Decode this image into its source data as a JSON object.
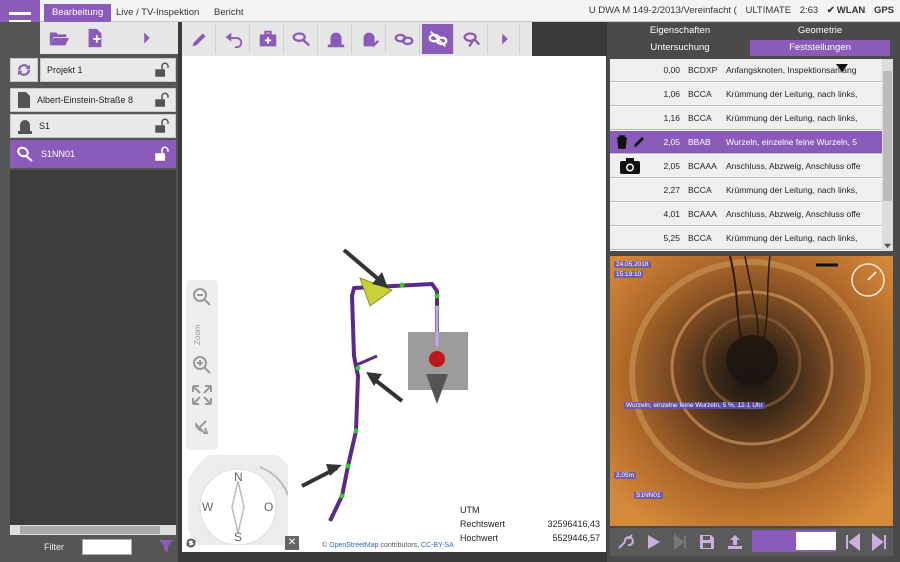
{
  "menu": {
    "tabs": [
      "Bearbeitung",
      "Live / TV-Inspektion",
      "Bericht"
    ],
    "active_tab": 0
  },
  "status": {
    "standard": "U  DWA M 149-2/2013/Vereinfacht (",
    "edition": "ULTIMATE",
    "time": "2:63",
    "wlan": "WLAN",
    "gps": "GPS"
  },
  "project_tree": [
    {
      "label": "Projekt 1",
      "icon": "refresh-icon"
    },
    {
      "label": "Albert-Einstein-Straße 8",
      "icon": "document-icon"
    },
    {
      "label": "S1",
      "icon": "manhole-icon"
    },
    {
      "label": "S1NN01",
      "icon": "pipe-icon",
      "selected": true
    }
  ],
  "filter": {
    "label": "Filter",
    "value": ""
  },
  "map": {
    "zoom_label": "Zoom",
    "compass": {
      "n": "N",
      "w": "W",
      "o": "O",
      "s": "S"
    },
    "utm": {
      "title": "UTM",
      "rechtswert_label": "Rechtswert",
      "rechtswert": "32596416,43",
      "hochwert_label": "Hochwert",
      "hochwert": "5529446,57"
    },
    "attribution": {
      "copy": "©",
      "osm": "OpenStreetMap",
      "contrib": "contributors,",
      "license": "CC-BY-SA"
    }
  },
  "right_tabs": {
    "upper": [
      {
        "label": "Eigenschaften"
      },
      {
        "label": "Geometrie"
      }
    ],
    "lower": [
      {
        "label": "Untersuchung"
      },
      {
        "label": "Feststellungen",
        "active": true
      }
    ]
  },
  "observations": [
    {
      "dist": "0,00",
      "code": "BCDXP",
      "desc": "Anfangsknoten, Inspektionsanfang"
    },
    {
      "dist": "1,06",
      "code": "BCCA",
      "desc": "Krümmung der Leitung, nach links,"
    },
    {
      "dist": "1,16",
      "code": "BCCA",
      "desc": "Krümmung der Leitung, nach links,"
    },
    {
      "dist": "2,05",
      "code": "BBAB",
      "desc": "Wurzeln, einzelne feine Wurzeln, 5",
      "selected": true
    },
    {
      "dist": "2,05",
      "code": "BCAAA",
      "desc": "Anschluss, Abzweig, Anschluss offe",
      "icon": "camera-icon"
    },
    {
      "dist": "2,27",
      "code": "BCCA",
      "desc": "Krümmung der Leitung, nach links,"
    },
    {
      "dist": "4,01",
      "code": "BCAAA",
      "desc": "Anschluss, Abzweig, Anschluss offe"
    },
    {
      "dist": "5,25",
      "code": "BCCA",
      "desc": "Krümmung der Leitung, nach links,"
    }
  ],
  "video": {
    "date": "24.05.2018",
    "time": "15:19:10",
    "caption": "Wurzeln, einzelne feine Wurzeln, 5 %, 12-1 Uhr",
    "distance": "2,05m",
    "section": "S1NN01"
  },
  "colors": {
    "accent": "#8a5bb8",
    "pipe": "#5b2a86"
  }
}
